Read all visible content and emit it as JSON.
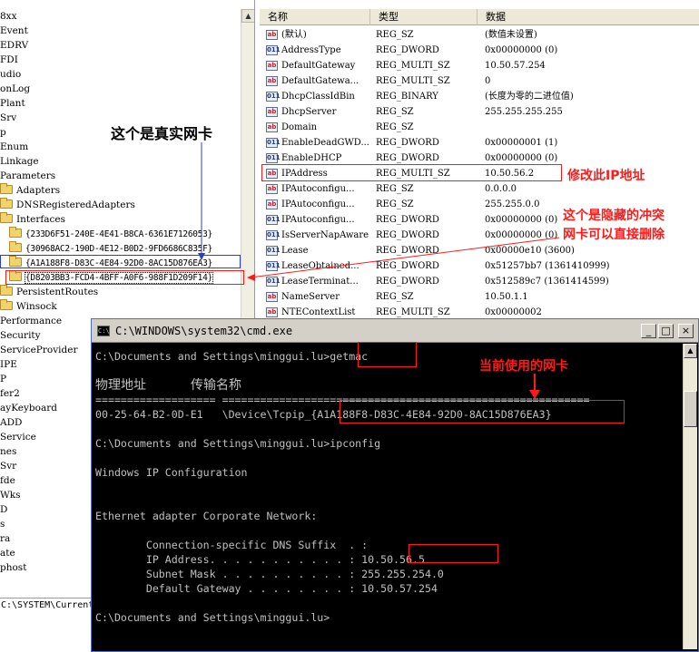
{
  "tree": {
    "items": [
      {
        "label": "8xx",
        "indent": 0,
        "folder": false
      },
      {
        "label": "Event",
        "indent": 0,
        "folder": false
      },
      {
        "label": "EDRV",
        "indent": 0,
        "folder": false
      },
      {
        "label": "FDI",
        "indent": 0,
        "folder": false
      },
      {
        "label": "udio",
        "indent": 0,
        "folder": false
      },
      {
        "label": "onLog",
        "indent": 0,
        "folder": false
      },
      {
        "label": "Plant",
        "indent": 0,
        "folder": false
      },
      {
        "label": "Srv",
        "indent": 0,
        "folder": false
      },
      {
        "label": "p",
        "indent": 0,
        "folder": false
      },
      {
        "label": "Enum",
        "indent": 0,
        "folder": false
      },
      {
        "label": "Linkage",
        "indent": 0,
        "folder": false
      },
      {
        "label": "Parameters",
        "indent": 0,
        "folder": false
      },
      {
        "label": "Adapters",
        "indent": 1,
        "folder": true
      },
      {
        "label": "DNSRegisteredAdapters",
        "indent": 1,
        "folder": true
      },
      {
        "label": "Interfaces",
        "indent": 1,
        "folder": true
      },
      {
        "label": "{233D6F51-240E-4E41-B8CA-6361E7126053}",
        "indent": 2,
        "folder": true,
        "guid": true
      },
      {
        "label": "{30968AC2-190D-4E12-B0D2-9FD6686C835F}",
        "indent": 2,
        "folder": true,
        "guid": true
      },
      {
        "label": "{A1A188F8-D83C-4E84-92D0-8AC15D876EA3}",
        "indent": 2,
        "folder": true,
        "guid": true
      },
      {
        "label": "{D8203BB3-FCD4-4BFF-A0F6-988F1D209F14}",
        "indent": 2,
        "folder": true,
        "guid": true,
        "selected": true
      },
      {
        "label": "PersistentRoutes",
        "indent": 1,
        "folder": true
      },
      {
        "label": "Winsock",
        "indent": 1,
        "folder": true
      },
      {
        "label": "Performance",
        "indent": 0,
        "folder": false
      },
      {
        "label": "Security",
        "indent": 0,
        "folder": false
      },
      {
        "label": "ServiceProvider",
        "indent": 0,
        "folder": false
      },
      {
        "label": "IPE",
        "indent": 0,
        "folder": false
      },
      {
        "label": "P",
        "indent": 0,
        "folder": false
      },
      {
        "label": "fer2",
        "indent": 0,
        "folder": false
      },
      {
        "label": "ayKeyboard",
        "indent": 0,
        "folder": false
      },
      {
        "label": "ADD",
        "indent": 0,
        "folder": false
      },
      {
        "label": "Service",
        "indent": 0,
        "folder": false
      },
      {
        "label": "nes",
        "indent": 0,
        "folder": false
      },
      {
        "label": "Svr",
        "indent": 0,
        "folder": false
      },
      {
        "label": "fde",
        "indent": 0,
        "folder": false
      },
      {
        "label": "Wks",
        "indent": 0,
        "folder": false
      },
      {
        "label": "D",
        "indent": 0,
        "folder": false
      },
      {
        "label": "s",
        "indent": 0,
        "folder": false
      },
      {
        "label": "ra",
        "indent": 0,
        "folder": false
      },
      {
        "label": "ate",
        "indent": 0,
        "folder": false
      },
      {
        "label": "phost",
        "indent": 0,
        "folder": false
      }
    ],
    "status_path": "C:\\SYSTEM\\CurrentC"
  },
  "list": {
    "headers": {
      "name": "名称",
      "type": "类型",
      "data": "数据"
    },
    "rows": [
      {
        "icon": "ab",
        "name": "(默认)",
        "type": "REG_SZ",
        "data": "(数值未设置)"
      },
      {
        "icon": "bin",
        "name": "AddressType",
        "type": "REG_DWORD",
        "data": "0x00000000 (0)"
      },
      {
        "icon": "ab",
        "name": "DefaultGateway",
        "type": "REG_MULTI_SZ",
        "data": "10.50.57.254"
      },
      {
        "icon": "ab",
        "name": "DefaultGatewa...",
        "type": "REG_MULTI_SZ",
        "data": "0"
      },
      {
        "icon": "bin",
        "name": "DhcpClassIdBin",
        "type": "REG_BINARY",
        "data": "(长度为零的二进位值)"
      },
      {
        "icon": "ab",
        "name": "DhcpServer",
        "type": "REG_SZ",
        "data": "255.255.255.255"
      },
      {
        "icon": "ab",
        "name": "Domain",
        "type": "REG_SZ",
        "data": ""
      },
      {
        "icon": "bin",
        "name": "EnableDeadGWD...",
        "type": "REG_DWORD",
        "data": "0x00000001 (1)"
      },
      {
        "icon": "bin",
        "name": "EnableDHCP",
        "type": "REG_DWORD",
        "data": "0x00000000 (0)"
      },
      {
        "icon": "ab",
        "name": "IPAddress",
        "type": "REG_MULTI_SZ",
        "data": "10.50.56.2"
      },
      {
        "icon": "ab",
        "name": "IPAutoconfigu...",
        "type": "REG_SZ",
        "data": "0.0.0.0"
      },
      {
        "icon": "ab",
        "name": "IPAutoconfigu...",
        "type": "REG_SZ",
        "data": "255.255.0.0"
      },
      {
        "icon": "bin",
        "name": "IPAutoconfigu...",
        "type": "REG_DWORD",
        "data": "0x00000000 (0)"
      },
      {
        "icon": "bin",
        "name": "IsServerNapAware",
        "type": "REG_DWORD",
        "data": "0x00000000 (0)"
      },
      {
        "icon": "bin",
        "name": "Lease",
        "type": "REG_DWORD",
        "data": "0x00000e10 (3600)"
      },
      {
        "icon": "bin",
        "name": "LeaseObtained...",
        "type": "REG_DWORD",
        "data": "0x51257bb7 (1361410999)"
      },
      {
        "icon": "bin",
        "name": "LeaseTerminat...",
        "type": "REG_DWORD",
        "data": "0x512589c7 (1361414599)"
      },
      {
        "icon": "ab",
        "name": "NameServer",
        "type": "REG_SZ",
        "data": "10.50.1.1"
      },
      {
        "icon": "ab",
        "name": "NTEContextList",
        "type": "REG_MULTI_SZ",
        "data": "0x00000002"
      }
    ]
  },
  "cmd": {
    "title": "C:\\WINDOWS\\system32\\cmd.exe",
    "icon_text": "C:\\",
    "buttons": {
      "minimize": "_",
      "maximize": "□",
      "close": "×"
    },
    "lines": [
      "C:\\Documents and Settings\\minggui.lu>getmac",
      "",
      "物理地址           传输名称",
      "=================== ==========================================================",
      "00-25-64-B2-0D-E1   \\Device\\Tcpip_{A1A188F8-D83C-4E84-92D0-8AC15D876EA3}",
      "",
      "C:\\Documents and Settings\\minggui.lu>ipconfig",
      "",
      "Windows IP Configuration",
      "",
      "",
      "Ethernet adapter Corporate Network:",
      "",
      "        Connection-specific DNS Suffix  . :",
      "        IP Address. . . . . . . . . . . : 10.50.56.5",
      "        Subnet Mask . . . . . . . . . . : 255.255.254.0",
      "        Default Gateway . . . . . . . . : 10.50.57.254",
      "",
      "C:\\Documents and Settings\\minggui.lu>"
    ]
  },
  "annotations": {
    "real_nic": "这个是真实网卡",
    "modify_ip": "修改此IP地址",
    "hidden_conflict_line1": "这个是隐藏的冲突",
    "hidden_conflict_line2": "网卡可以直接删除",
    "current_nic": "当前使用的网卡"
  },
  "colors": {
    "annotation_red": "#ff1a1a",
    "annotation_blue": "#2a3fd0",
    "console_text": "#c0c0c0"
  }
}
